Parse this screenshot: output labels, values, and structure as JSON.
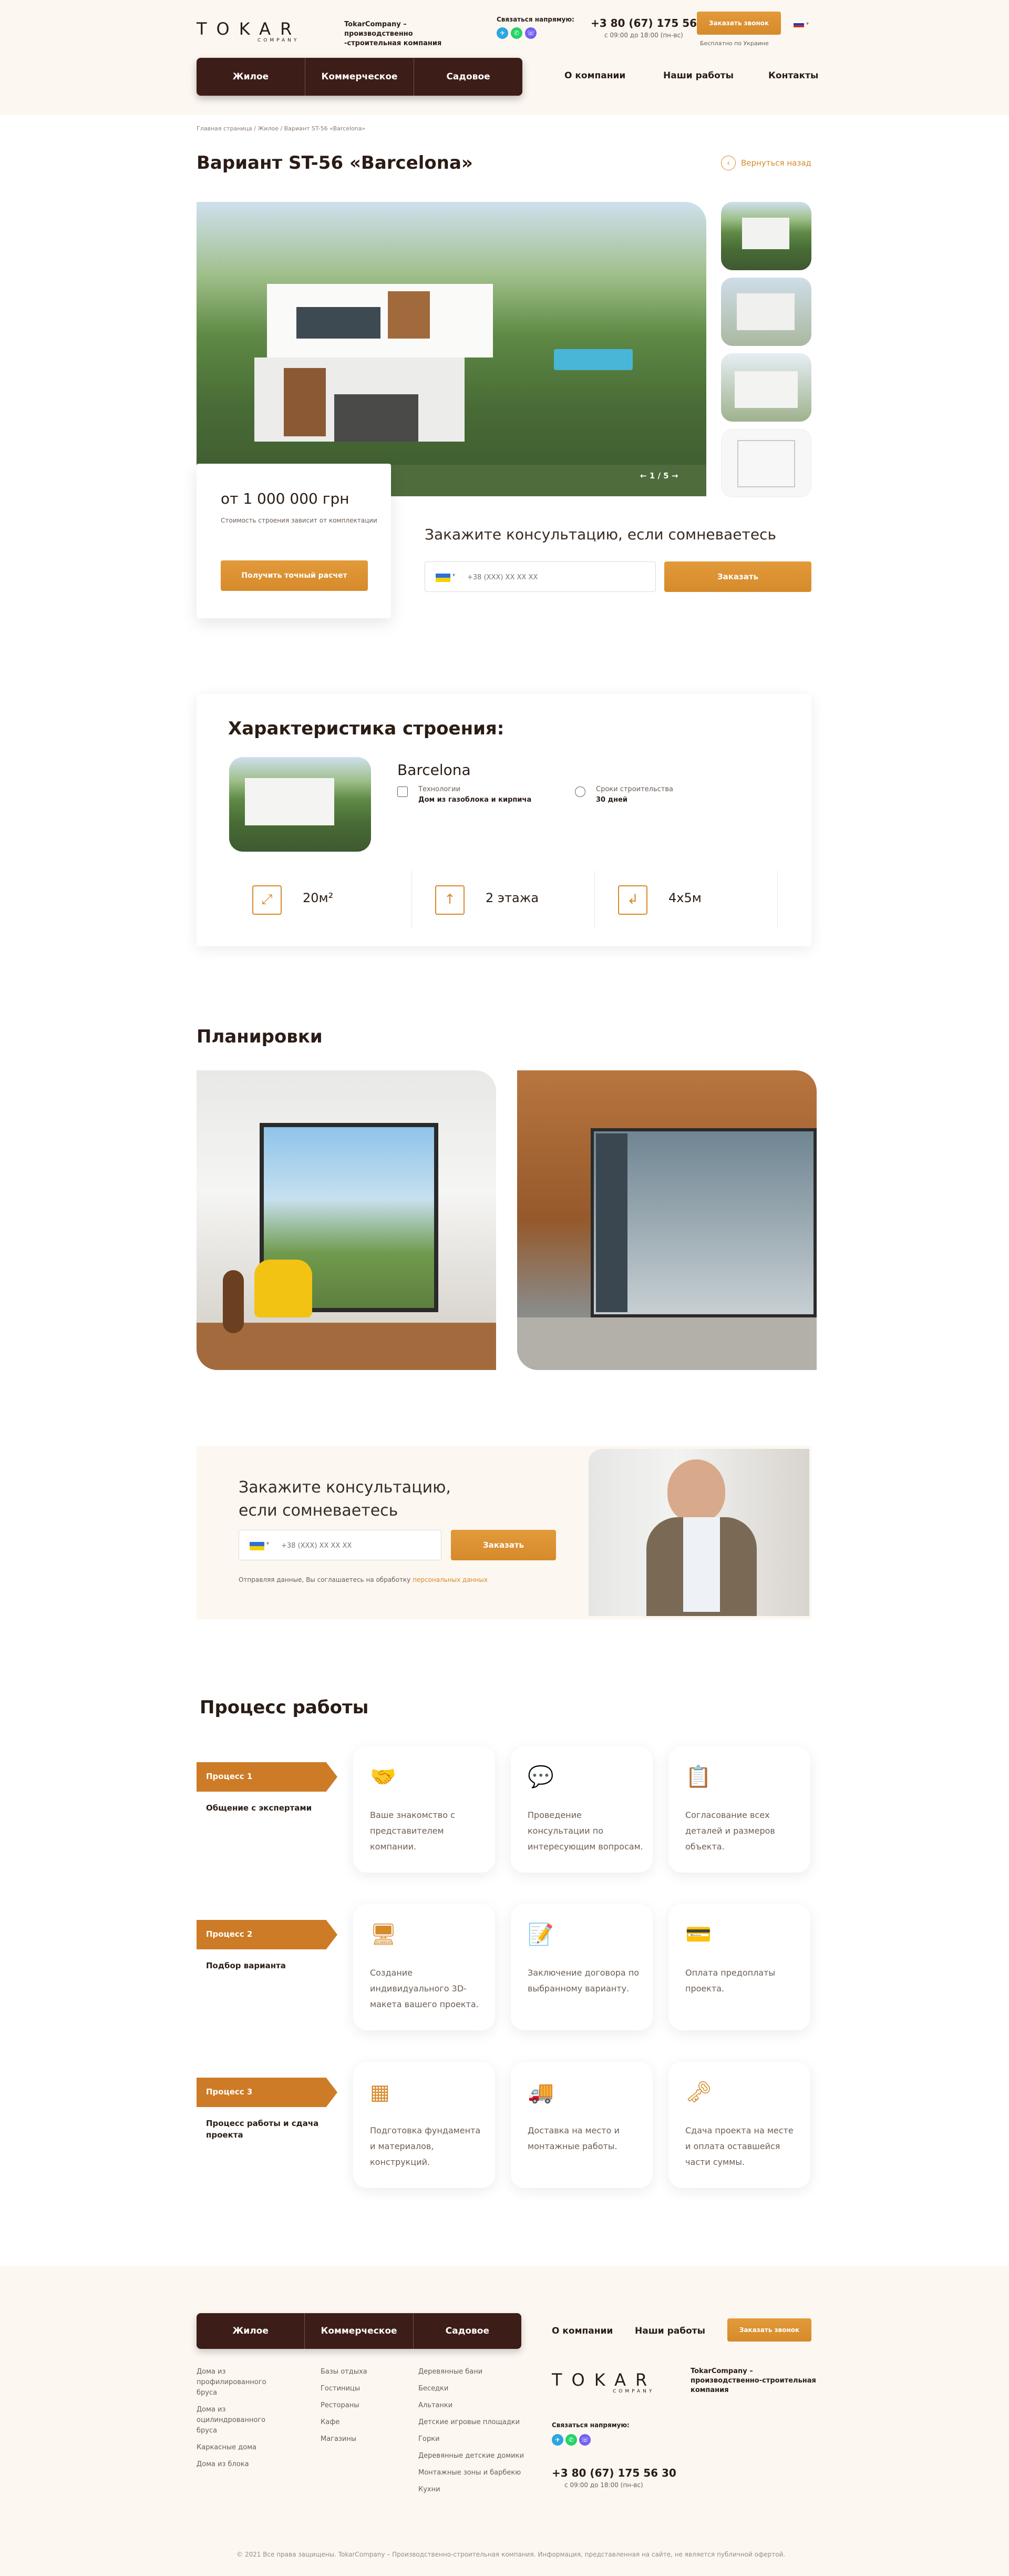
{
  "header": {
    "logo_word": "TOKAR",
    "logo_sub": "COMPANY",
    "tagline": "TokarCompany – производственно -строительная компания",
    "contact_label": "Связаться напрямую:",
    "phone": "+3 80 (67) 175 56 30",
    "hours": "с 09:00 до 18:00 (пн-вс)",
    "cta": "Заказать звонок",
    "cta_note": "Бесплатно по Украине",
    "nav": [
      "Жилое",
      "Коммерческое",
      "Садовое"
    ],
    "secondary_nav": [
      "О компании",
      "Наши работы",
      "Контакты"
    ]
  },
  "breadcrumbs": "Главная страница  /  Жилое  /  Вариант ST-56 «Barcelona»",
  "page_title": "Вариант ST-56 «Barcelona»",
  "back_label": "Вернуться назад",
  "gallery": {
    "counter": "1 / 5"
  },
  "price": {
    "value": "от 1 000 000 грн",
    "note": "Стоимость строения зависит от комплектации",
    "button": "Получить точный расчет"
  },
  "consult": {
    "title": "Закажите консультацию, если сомневаетесь",
    "placeholder": "+38 (XXX) XX XX XX",
    "button": "Заказать"
  },
  "specs": {
    "title": "Характеристика строения:",
    "name": "Barcelona",
    "tech_label": "Технологии",
    "tech_value": "Дом из газоблока и кирпича",
    "term_label": "Сроки строительства",
    "term_value": "30 дней",
    "area": "20м²",
    "floors": "2 этажа",
    "size": "4x5м"
  },
  "plans_title": "Планировки",
  "consult2": {
    "title_line1": "Закажите консультацию,",
    "title_line2": "если сомневаетесь",
    "placeholder": "+38 (XXX) XX XX XX",
    "button": "Заказать",
    "note": "Отправляя данные, Вы соглашаетесь на обработку",
    "note_link": "персональных данных"
  },
  "process": {
    "title": "Процесс работы",
    "stages": [
      {
        "label": "Процесс 1",
        "desc": "Общение с экспертами",
        "cards": [
          "Ваше знакомство с представителем компании.",
          "Проведение консультации по интересующим вопросам.",
          "Согласование всех деталей и размеров объекта."
        ]
      },
      {
        "label": "Процесс 2",
        "desc": "Подбор варианта",
        "cards": [
          "Создание индивидуального 3D-макета вашего проекта.",
          "Заключение договора по выбранному варианту.",
          "Оплата предоплаты проекта."
        ]
      },
      {
        "label": "Процесс 3",
        "desc": "Процесс работы и сдача проекта",
        "cards": [
          "Подготовка фундамента и материалов, конструкций.",
          "Доставка на место и монтажные работы.",
          "Сдача проекта на месте и оплата оставшейся части суммы."
        ]
      }
    ]
  },
  "footer": {
    "nav": [
      "Жилое",
      "Коммерческое",
      "Садовое"
    ],
    "secondary_nav": [
      "О компании",
      "Наши работы"
    ],
    "cta": "Заказать звонок",
    "col1": [
      "Дома из профилированного бруса",
      "Дома из оцилиндрованного бруса",
      "Каркасные дома",
      "Дома из блока"
    ],
    "col2": [
      "Базы отдыха",
      "Гостиницы",
      "Рестораны",
      "Кафе",
      "Магазины"
    ],
    "col3": [
      "Деревянные бани",
      "Беседки",
      "Альтанки",
      "Детские игровые площадки",
      "Горки",
      "Деревянные детские домики",
      "Монтажные зоны и барбекю",
      "Кухни"
    ],
    "tagline": "TokarCompany – производственно-строительная компания",
    "contact_label": "Связаться напрямую:",
    "phone": "+3 80 (67) 175 56 30",
    "hours": "с 09:00 до 18:00 (пн-вс)",
    "copyright": "© 2021 Все права защищены. TokarCompany – Производственно-строительная компания. Информация, представленная на сайте, не является публичной офертой."
  },
  "colors": {
    "accent": "#d68a2b",
    "dark": "#3d1d18",
    "cream": "#fcf7f1"
  }
}
